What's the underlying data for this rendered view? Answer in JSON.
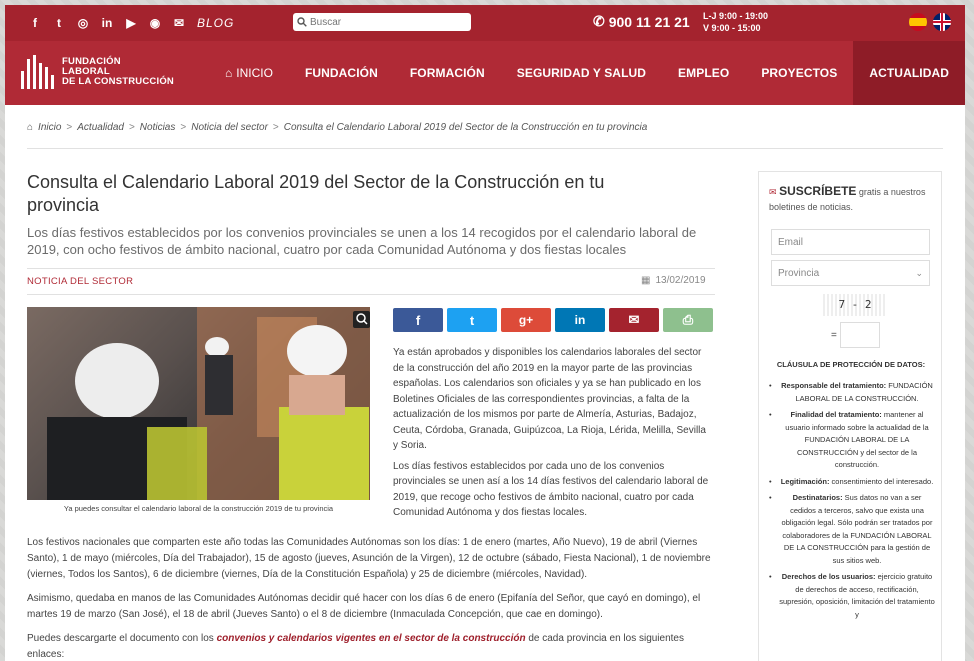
{
  "topbar": {
    "social": [
      {
        "icon": "facebook-icon",
        "glyph": "f"
      },
      {
        "icon": "twitter-icon",
        "glyph": "t"
      },
      {
        "icon": "instagram-icon",
        "glyph": "◎"
      },
      {
        "icon": "linkedin-icon",
        "glyph": "in"
      },
      {
        "icon": "youtube-icon",
        "glyph": "▶"
      },
      {
        "icon": "rss-icon",
        "glyph": "◉"
      },
      {
        "icon": "mail-icon",
        "glyph": "✉"
      }
    ],
    "blog_label": "BLOG",
    "search_placeholder": "Buscar",
    "phone": "900 11 21 21",
    "hours_line1": "L-J 9:00 - 19:00",
    "hours_line2": "V 9:00 - 15:00"
  },
  "header": {
    "logo_line1": "FUNDACIÓN",
    "logo_line2": "LABORAL",
    "logo_line3": "DE LA CONSTRUCCIÓN",
    "nav": [
      "INICIO",
      "FUNDACIÓN",
      "FORMACIÓN",
      "SEGURIDAD Y SALUD",
      "EMPLEO",
      "PROYECTOS",
      "ACTUALIDAD"
    ]
  },
  "breadcrumb": [
    "Inicio",
    "Actualidad",
    "Noticias",
    "Noticia del sector",
    "Consulta el Calendario Laboral 2019 del Sector de la Construcción en tu provincia"
  ],
  "article": {
    "title": "Consulta el Calendario Laboral 2019 del Sector de la Construcción en tu provincia",
    "subtitle": "Los días festivos establecidos por los convenios provinciales se unen a los 14 recogidos por el calendario laboral de 2019, con ocho festivos de ámbito nacional, cuatro por cada Comunidad Autónoma y dos fiestas locales",
    "category": "NOTICIA DEL SECTOR",
    "date": "13/02/2019",
    "caption": "Ya puedes consultar el calendario laboral de la construcción 2019 de tu provincia",
    "share_colors": {
      "facebook": "#3b5998",
      "twitter": "#1da1f2",
      "google": "#dd4b39",
      "linkedin": "#0077b5",
      "mail": "#a4232e",
      "print": "#8ec08e"
    },
    "para1": "Ya están aprobados y disponibles los calendarios laborales del sector de la construcción del año 2019 en la mayor parte de las provincias españolas. Los calendarios son oficiales y ya se han publicado en los Boletines Oficiales de las correspondientes provincias, a falta de la actualización de los mismos por parte de Almería, Asturias, Badajoz, Ceuta, Córdoba, Granada, Guipúzcoa, La Rioja, Lérida, Melilla, Sevilla y Soria.",
    "para2": "Los días festivos establecidos por cada uno de los convenios provinciales se unen así a los 14 días festivos del calendario laboral de 2019, que recoge ocho festivos de ámbito nacional, cuatro por cada Comunidad Autónoma y dos fiestas locales.",
    "para3": "Los festivos nacionales que comparten este año todas las Comunidades Autónomas son los días: 1 de enero (martes, Año Nuevo), 19 de abril (Viernes Santo), 1 de mayo (miércoles, Día del Trabajador), 15 de agosto (jueves, Asunción de la Virgen), 12 de octubre (sábado, Fiesta Nacional), 1 de noviembre (viernes, Todos los Santos), 6 de diciembre (viernes, Día de la Constitución Española) y 25 de diciembre (miércoles, Navidad).",
    "para4": "Asimismo, quedaba en manos de las Comunidades Autónomas decidir qué hacer con los días 6 de enero (Epifanía del Señor, que cayó en domingo), el martes 19 de marzo (San José), el 18 de abril (Jueves Santo) o el 8 de diciembre (Inmaculada Concepción, que cae en domingo).",
    "para5_before": "Puedes descargarte el documento con los ",
    "para5_link": "convenios y calendarios vigentes en el sector de la construcción",
    "para5_after": " de cada provincia en los siguientes enlaces:"
  },
  "sidebar": {
    "subscribe_title": "SUSCRÍBETE",
    "subscribe_rest": " gratis a nuestros boletines de noticias.",
    "email_placeholder": "Email",
    "province_placeholder": "Provincia",
    "captcha_text": "7 - 2",
    "equals": "=",
    "clause_title": "CLÁUSULA DE PROTECCIÓN DE DATOS:",
    "clauses": [
      {
        "key": "Responsable del tratamiento:",
        "value": " FUNDACIÓN LABORAL DE LA CONSTRUCCIÓN."
      },
      {
        "key": "Finalidad del tratamiento:",
        "value": " mantener al usuario informado sobre la actualidad de la FUNDACIÓN LABORAL DE LA CONSTRUCCIÓN y del sector de la construcción."
      },
      {
        "key": "Legitimación:",
        "value": " consentimiento del interesado."
      },
      {
        "key": "Destinatarios:",
        "value": " Sus datos no van a ser cedidos a terceros, salvo que exista una obligación legal. Sólo podrán ser tratados por colaboradores de la FUNDACIÓN LABORAL DE LA CONSTRUCCIÓN para la gestión de sus sitios web."
      },
      {
        "key": "Derechos de los usuarios:",
        "value": " ejercicio gratuito de derechos de acceso, rectificación, supresión, oposición, limitación del tratamiento y"
      }
    ]
  }
}
